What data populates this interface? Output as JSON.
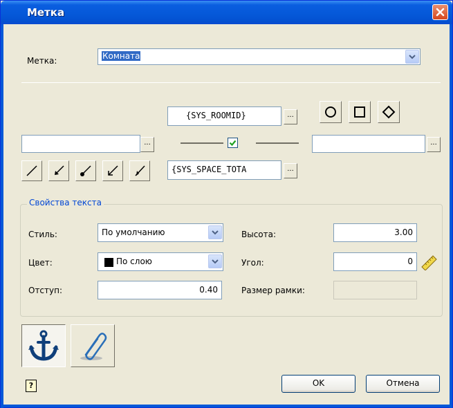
{
  "window": {
    "title": "Метка"
  },
  "label_row": {
    "label": "Метка:",
    "value": "Комната"
  },
  "top_field": {
    "value": "{SYS_ROOMID}",
    "browse": "..."
  },
  "bottom_field": {
    "value": "{SYS_SPACE_TOTA",
    "browse": "..."
  },
  "left_field": {
    "value": "",
    "browse": "..."
  },
  "right_field": {
    "value": "",
    "browse": "..."
  },
  "text_props": {
    "title": "Свойства текста",
    "style_label": "Стиль:",
    "style_value": "По умолчанию",
    "color_label": "Цвет:",
    "color_value": "По слою",
    "indent_label": "Отступ:",
    "indent_value": "0.40",
    "height_label": "Высота:",
    "height_value": "3.00",
    "angle_label": "Угол:",
    "angle_value": "0",
    "frame_label": "Размер рамки:",
    "frame_value": ""
  },
  "buttons": {
    "ok": "OK",
    "cancel": "Отмена"
  },
  "colors": {
    "title_bar": "#0558d8",
    "dialog_bg": "#ece9d8",
    "accent": "#0046d5"
  }
}
